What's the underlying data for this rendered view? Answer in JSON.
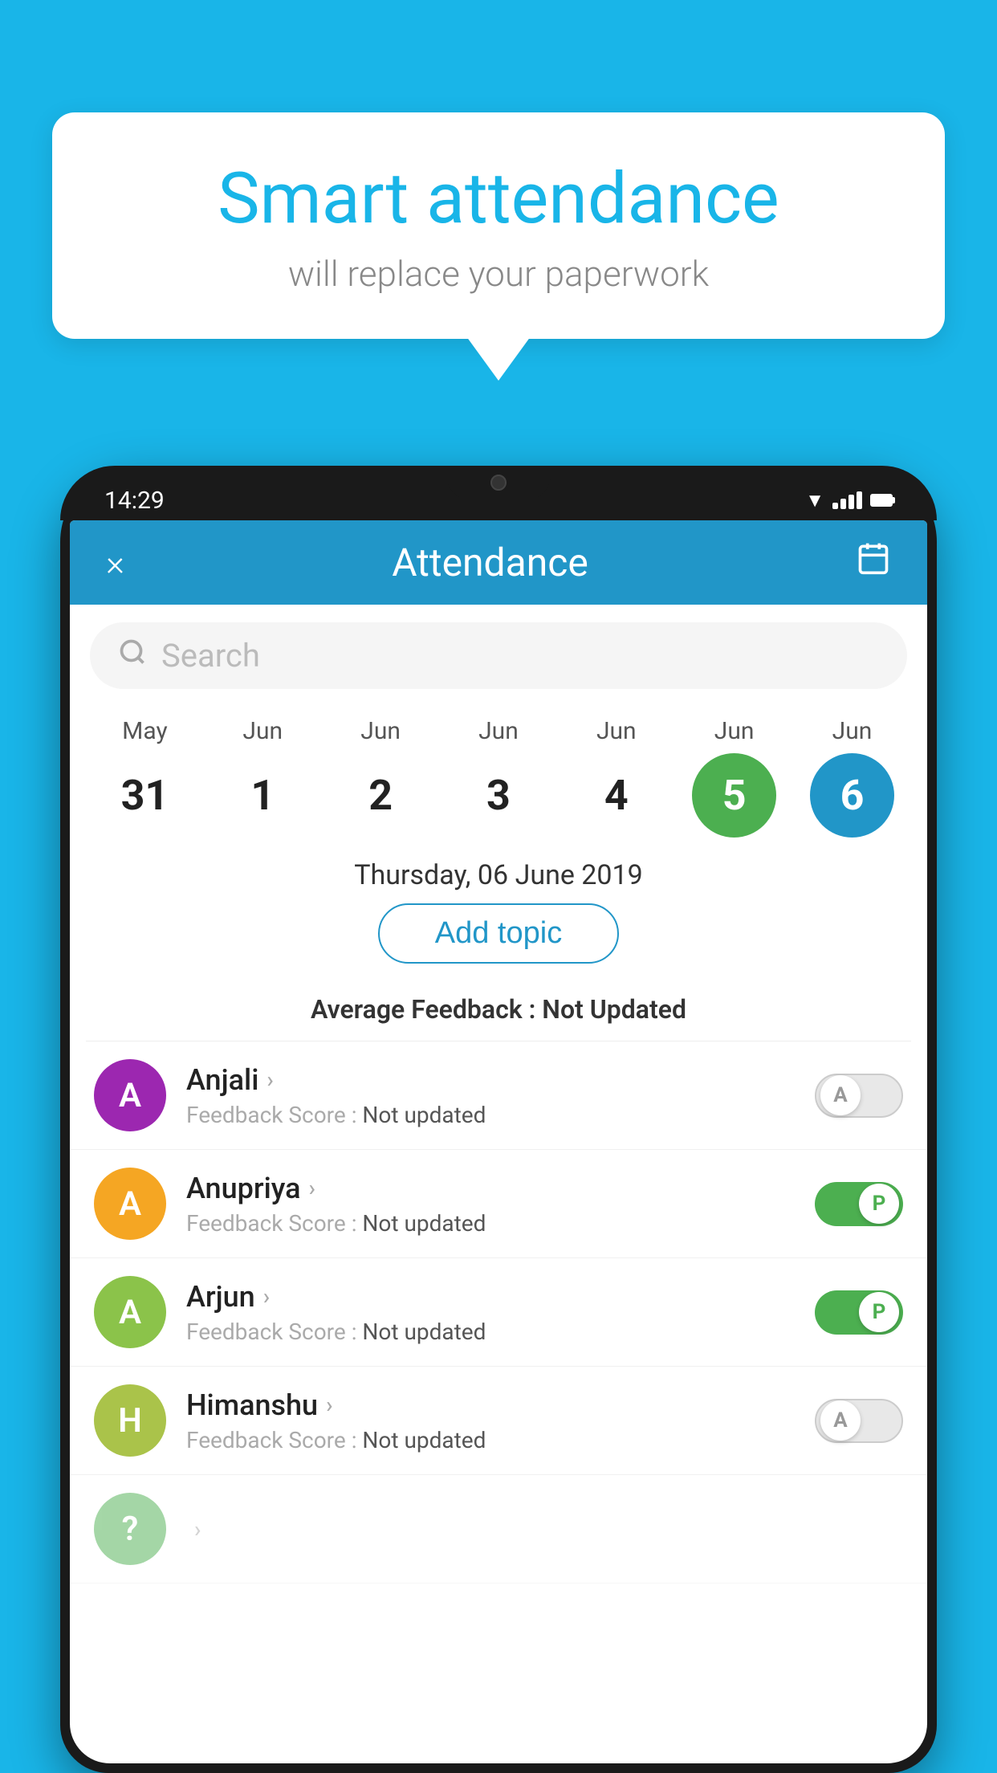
{
  "background_color": "#19b5e8",
  "speech_bubble": {
    "title": "Smart attendance",
    "subtitle": "will replace your paperwork"
  },
  "status_bar": {
    "time": "14:29"
  },
  "app_header": {
    "title": "Attendance",
    "close_label": "×",
    "calendar_label": "📅"
  },
  "search": {
    "placeholder": "Search"
  },
  "calendar": {
    "days": [
      {
        "month": "May",
        "date": "31",
        "style": "normal"
      },
      {
        "month": "Jun",
        "date": "1",
        "style": "normal"
      },
      {
        "month": "Jun",
        "date": "2",
        "style": "normal"
      },
      {
        "month": "Jun",
        "date": "3",
        "style": "normal"
      },
      {
        "month": "Jun",
        "date": "4",
        "style": "normal"
      },
      {
        "month": "Jun",
        "date": "5",
        "style": "today"
      },
      {
        "month": "Jun",
        "date": "6",
        "style": "selected"
      }
    ]
  },
  "date_label": "Thursday, 06 June 2019",
  "add_topic_label": "Add topic",
  "feedback_label": "Average Feedback :",
  "feedback_value": "Not Updated",
  "students": [
    {
      "name": "Anjali",
      "avatar_letter": "A",
      "avatar_color": "#9c27b0",
      "feedback": "Feedback Score :",
      "feedback_value": "Not updated",
      "toggle": "off",
      "toggle_letter": "A"
    },
    {
      "name": "Anupriya",
      "avatar_letter": "A",
      "avatar_color": "#f5a623",
      "feedback": "Feedback Score :",
      "feedback_value": "Not updated",
      "toggle": "on",
      "toggle_letter": "P"
    },
    {
      "name": "Arjun",
      "avatar_letter": "A",
      "avatar_color": "#8bc34a",
      "feedback": "Feedback Score :",
      "feedback_value": "Not updated",
      "toggle": "on",
      "toggle_letter": "P"
    },
    {
      "name": "Himanshu",
      "avatar_letter": "H",
      "avatar_color": "#aac34a",
      "feedback": "Feedback Score :",
      "feedback_value": "Not updated",
      "toggle": "off",
      "toggle_letter": "A"
    }
  ]
}
